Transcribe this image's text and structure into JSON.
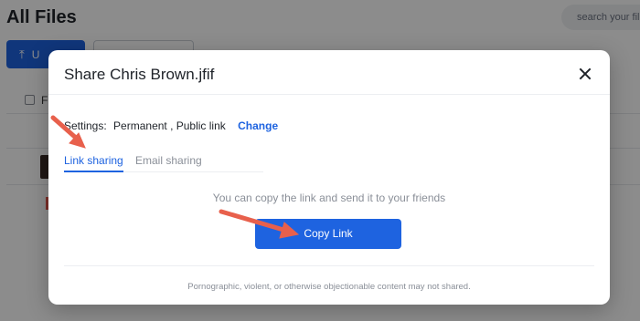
{
  "page": {
    "title": "All Files",
    "search_placeholder": "search your files",
    "upload_label": "U",
    "column_label": "F"
  },
  "modal": {
    "title": "Share Chris Brown.jfif",
    "settings_label": "Settings:",
    "settings_value": "Permanent , Public link",
    "change_label": "Change",
    "tabs": [
      {
        "label": "Link sharing",
        "active": true
      },
      {
        "label": "Email sharing",
        "active": false
      }
    ],
    "hint": "You can copy the link and send it to your friends",
    "copy_button": "Copy Link",
    "footer": "Pornographic, violent, or otherwise objectionable content may not shared."
  },
  "colors": {
    "accent": "#1e63e0",
    "annotation_arrow": "#e8604c"
  },
  "icons": {
    "close": "close-icon",
    "upload": "upload-icon"
  }
}
